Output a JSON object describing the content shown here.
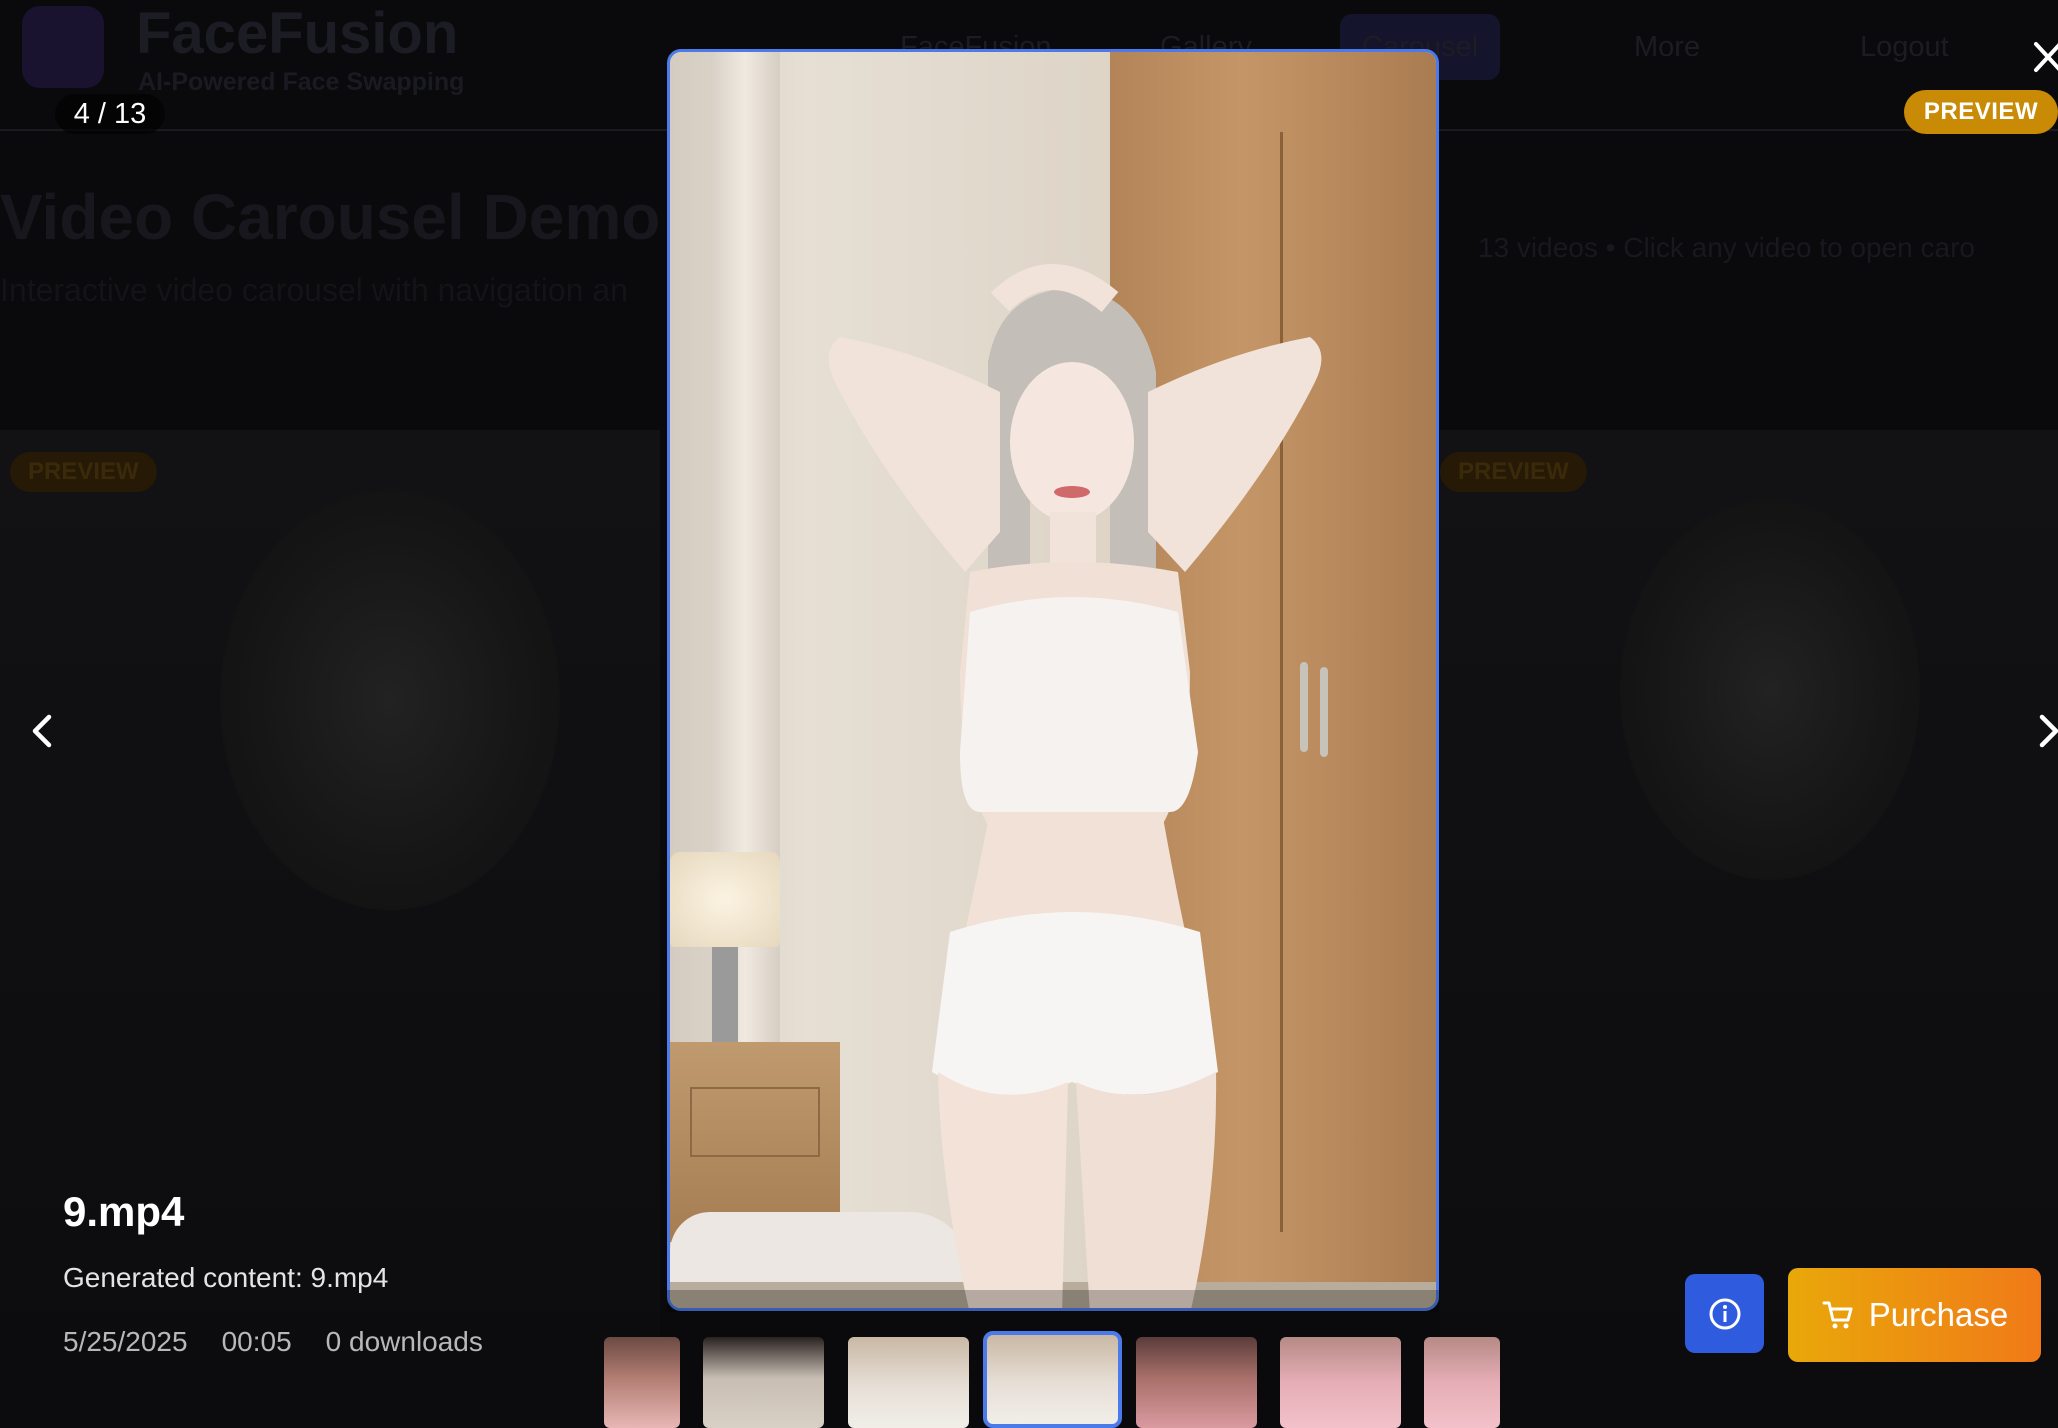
{
  "background": {
    "brand": "FaceFusion",
    "tagline": "AI-Powered Face Swapping",
    "nav": [
      {
        "label": "FaceFusion"
      },
      {
        "label": "Gallery"
      },
      {
        "label": "Carousel"
      },
      {
        "label": "More"
      },
      {
        "label": "Logout"
      }
    ],
    "title": "Video Carousel Demo",
    "subtitle": "Interactive video carousel with navigation an",
    "meta": "13 videos   •   Click any video to open caro",
    "card_badge": "PREVIEW"
  },
  "modal": {
    "counter": "4 / 13",
    "preview_badge": "PREVIEW",
    "file": {
      "title": "9.mp4",
      "description": "Generated content: 9.mp4",
      "date": "5/25/2025",
      "duration": "00:05",
      "downloads": "0 downloads"
    },
    "purchase_label": "Purchase",
    "thumbnail_count": 7,
    "active_thumbnail": 4
  },
  "colors": {
    "accent_blue": "#4b7bea",
    "info_button": "#2f5bde",
    "preview_badge": "#c98a06",
    "purchase_gradient_start": "#e9a80a",
    "purchase_gradient_end": "#f07a18"
  },
  "icons": [
    "close-icon",
    "chevron-left-icon",
    "chevron-right-icon",
    "info-icon",
    "cart-icon"
  ]
}
